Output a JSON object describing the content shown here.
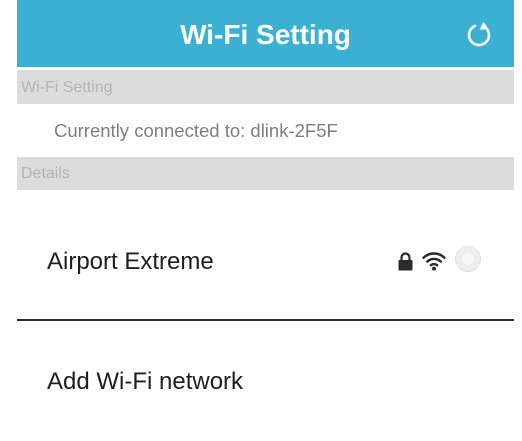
{
  "header": {
    "title": "Wi-Fi Setting",
    "refresh_icon": "refresh-icon",
    "color": "#3ab1d3"
  },
  "sections": {
    "wifi_setting_label": "Wi-Fi Setting",
    "details_label": "Details"
  },
  "connection": {
    "status_text": "Currently connected to: dlink-2F5F"
  },
  "networks": [
    {
      "name": "Airport Extreme",
      "secured": true,
      "icons": [
        "lock-icon",
        "wifi-signal-icon"
      ],
      "selected": false
    }
  ],
  "add_network": {
    "label": "Add Wi-Fi network"
  }
}
